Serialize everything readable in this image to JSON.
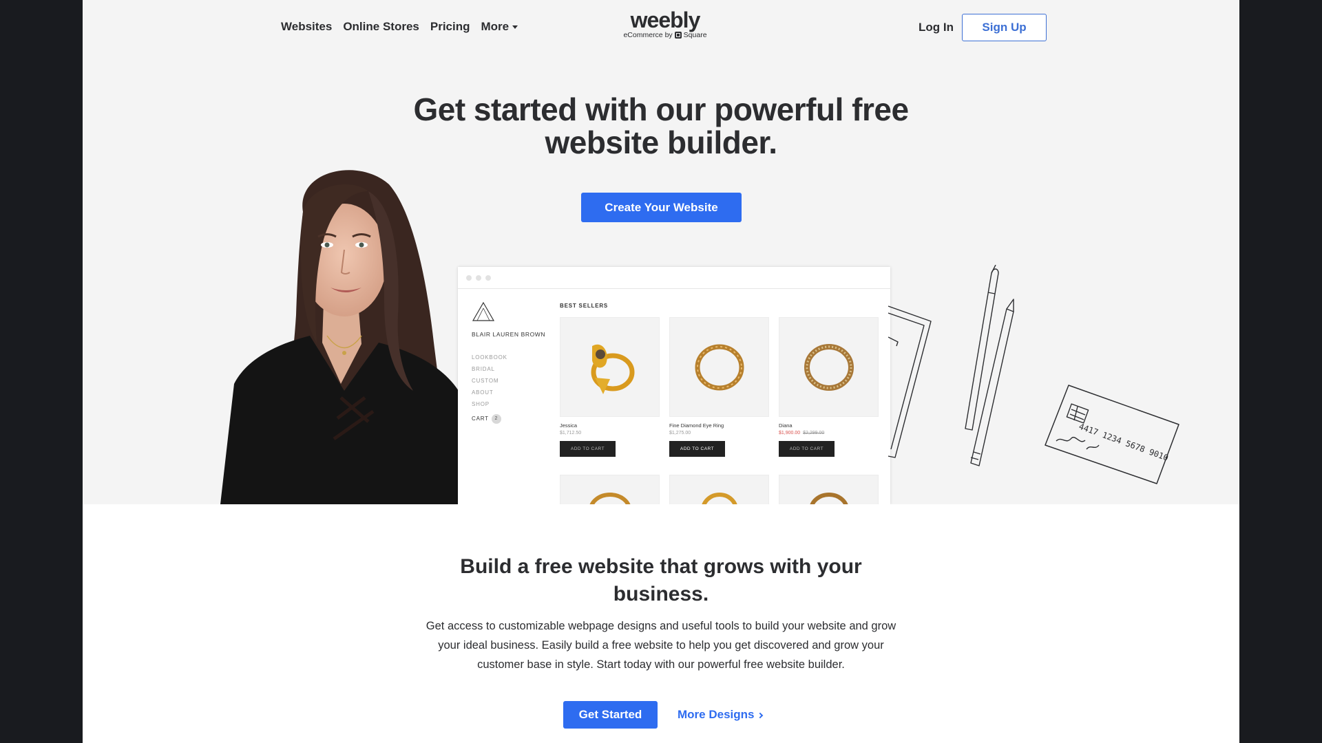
{
  "header": {
    "nav": [
      "Websites",
      "Online Stores",
      "Pricing",
      "More"
    ],
    "logo": {
      "word": "weebly",
      "sub_prefix": "eCommerce by",
      "sub_brand": "Square"
    },
    "login_label": "Log In",
    "signup_label": "Sign Up"
  },
  "hero": {
    "title": "Get started with our powerful free website builder.",
    "cta_label": "Create Your Website"
  },
  "mockup": {
    "brand": "BLAIR LAUREN BROWN",
    "menu": [
      "LOOKBOOK",
      "BRIDAL",
      "CUSTOM",
      "ABOUT",
      "SHOP"
    ],
    "cart_label": "CART",
    "cart_count": "2",
    "section_label": "BEST SELLERS",
    "products": [
      {
        "name": "Jessica",
        "price": "$1,712.50",
        "button": "ADD TO CART"
      },
      {
        "name": "Fine Diamond Eye Ring",
        "price": "$1,275.00",
        "button": "ADD TO CART"
      },
      {
        "name": "Diana",
        "sale_price": "$1,900.00",
        "old_price": "$2,299.00",
        "button": "ADD TO CART"
      }
    ],
    "card_number": "4417 1234 5678 9010"
  },
  "section": {
    "title": "Build a free website that grows with your business.",
    "body": "Get access to customizable webpage designs and useful tools to build your website and grow your ideal business. Easily build a free website to help you get discovered and grow your customer base in style. Start today with our powerful free website builder.",
    "primary_label": "Get Started",
    "secondary_label": "More Designs"
  },
  "colors": {
    "accent": "#2e6cf0",
    "hero_bg": "#f4f4f4",
    "text": "#2c2d30",
    "frame": "#191b1f"
  }
}
